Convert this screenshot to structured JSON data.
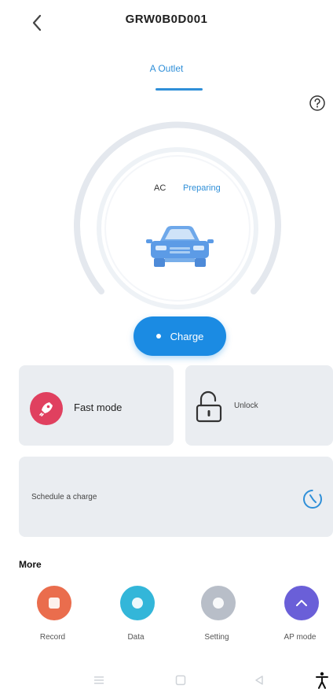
{
  "header": {
    "title": "GRW0B0D001",
    "back_icon": "chevron-left-icon"
  },
  "tabs": [
    {
      "label": "A Outlet",
      "active": true
    }
  ],
  "help_icon": "question-circle-icon",
  "status": {
    "type": "AC",
    "state": "Preparing"
  },
  "charge_button": {
    "label": "Charge",
    "color": "#1b8be3"
  },
  "cards": {
    "fast_mode": {
      "label": "Fast mode",
      "icon": "rocket-icon",
      "color": "#e0405f"
    },
    "unlock": {
      "label": "Unlock",
      "icon": "unlock-icon"
    },
    "schedule": {
      "label": "Schedule a charge",
      "icon": "clock-icon"
    }
  },
  "more": {
    "title": "More",
    "items": [
      {
        "label": "Record",
        "icon": "record-icon",
        "color": "#ea6d4d"
      },
      {
        "label": "Data",
        "icon": "data-icon",
        "color": "#33b6d9"
      },
      {
        "label": "Setting",
        "icon": "gear-icon",
        "color": "#b8bec8"
      },
      {
        "label": "AP mode",
        "icon": "ap-mode-icon",
        "color": "#6a5fd8"
      }
    ]
  },
  "system_nav": [
    "menu-icon",
    "home-icon",
    "back-icon",
    "accessibility-icon"
  ]
}
